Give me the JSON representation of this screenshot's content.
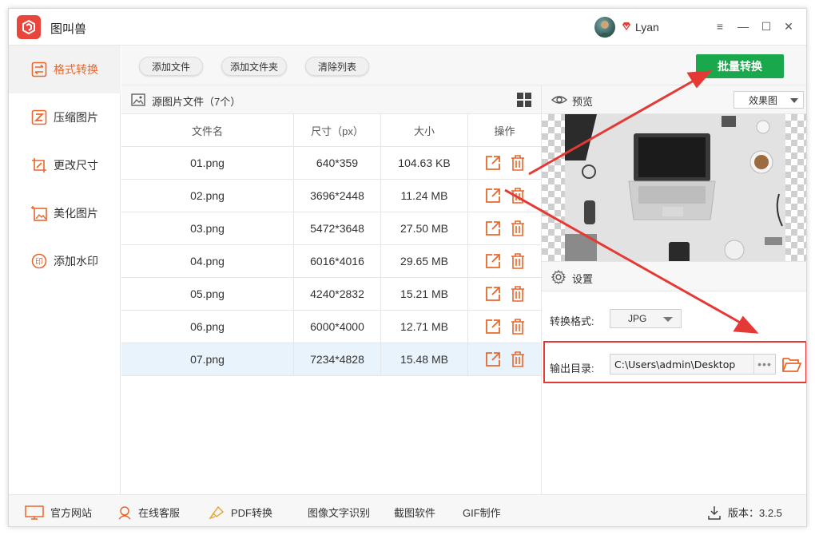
{
  "app": {
    "title": "图叫兽"
  },
  "user": {
    "name": "Lyan"
  },
  "window_controls": {
    "menu": "≡",
    "minimize": "—",
    "maximize": "☐",
    "close": "✕"
  },
  "sidebar": {
    "items": [
      {
        "label": "格式转换",
        "icon": "format-convert-icon",
        "active": true
      },
      {
        "label": "压缩图片",
        "icon": "compress-icon"
      },
      {
        "label": "更改尺寸",
        "icon": "resize-icon"
      },
      {
        "label": "美化图片",
        "icon": "beautify-icon"
      },
      {
        "label": "添加水印",
        "icon": "watermark-icon"
      }
    ]
  },
  "toolbar": {
    "add_file": "添加文件",
    "add_folder": "添加文件夹",
    "clear_list": "清除列表",
    "batch_convert": "批量转换"
  },
  "files": {
    "header_title": "源图片文件（7个）",
    "columns": [
      "文件名",
      "尺寸（px）",
      "大小",
      "操作"
    ],
    "rows": [
      {
        "name": "01.png",
        "size_px": "640*359",
        "size": "104.63 KB"
      },
      {
        "name": "02.png",
        "size_px": "3696*2448",
        "size": "11.24 MB"
      },
      {
        "name": "03.png",
        "size_px": "5472*3648",
        "size": "27.50 MB"
      },
      {
        "name": "04.png",
        "size_px": "6016*4016",
        "size": "29.65 MB"
      },
      {
        "name": "05.png",
        "size_px": "4240*2832",
        "size": "15.21 MB"
      },
      {
        "name": "06.png",
        "size_px": "6000*4000",
        "size": "12.71 MB"
      },
      {
        "name": "07.png",
        "size_px": "7234*4828",
        "size": "15.48 MB",
        "selected": true
      }
    ]
  },
  "preview": {
    "title": "预览",
    "mode": "效果图"
  },
  "settings": {
    "title": "设置",
    "format_label": "转换格式:",
    "format_value": "JPG",
    "output_label": "输出目录:",
    "output_value": "C:\\Users\\admin\\Desktop",
    "browse": "•••"
  },
  "statusbar": {
    "website": "官方网站",
    "support": "在线客服",
    "pdf": "PDF转换",
    "ocr": "图像文字识别",
    "screenshot": "截图软件",
    "gif": "GIF制作",
    "version": "版本：3.2.5"
  },
  "colors": {
    "accent": "#e8672c",
    "batch_button": "#19a84c",
    "highlight": "#e53935"
  }
}
